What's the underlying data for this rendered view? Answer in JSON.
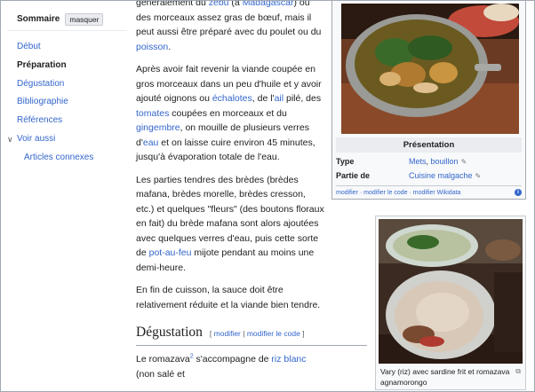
{
  "toc": {
    "title": "Sommaire",
    "hide_label": "masquer",
    "items": [
      {
        "label": "Début"
      },
      {
        "label": "Préparation"
      },
      {
        "label": "Dégustation"
      },
      {
        "label": "Bibliographie"
      },
      {
        "label": "Références"
      },
      {
        "label": "Voir aussi"
      },
      {
        "label": "Articles connexes"
      }
    ]
  },
  "content": {
    "p1_a": "généralement du ",
    "p1_zebu": "zébu",
    "p1_b": " (à ",
    "p1_madagascar": "Madagascar",
    "p1_c": ") ou des morceaux assez gras de bœuf, mais il peut aussi être préparé avec du poulet ou du ",
    "p1_poisson": "poisson",
    "p1_d": ".",
    "p2_a": "Après avoir fait revenir la viande coupée en gros morceaux dans un peu d'huile et y avoir ajouté oignons ou ",
    "p2_echalotes": "échalotes",
    "p2_b": ", de l'",
    "p2_ail": "ail",
    "p2_c": " pilé, des ",
    "p2_tomates": "tomates",
    "p2_d": " coupées en morceaux et du ",
    "p2_gingembre": "gingembre",
    "p2_e": ", on mouille de plusieurs verres d'",
    "p2_eau": "eau",
    "p2_f": " et on laisse cuire environ 45 minutes, jusqu'à évaporation totale de l'eau.",
    "p3_a": "Les parties tendres des brèdes (brèdes mafana, brèdes morelle, brèdes cresson, etc.) et quelques \"fleurs\" (des boutons floraux en fait) du brède mafana sont alors ajoutées avec quelques verres d'eau, puis cette sorte de ",
    "p3_potaufeu": "pot-au-feu",
    "p3_b": " mijote pendant au moins une demi-heure.",
    "p4": "En fin de cuisson, la sauce doit être relativement réduite et la viande bien tendre.",
    "h2": "Dégustation",
    "h2_edit_open": "[ ",
    "h2_edit_modifier": "modifier",
    "h2_edit_sep": " | ",
    "h2_edit_code": "modifier le code",
    "h2_edit_close": " ]",
    "p5_a": "Le romazava",
    "p5_ref": "2",
    "p5_b": " s'accompagne de ",
    "p5_riz": "riz blanc",
    "p5_c": " (non salé et"
  },
  "infobox": {
    "header": "Présentation",
    "rows": [
      {
        "key": "Type",
        "v1": "Mets",
        "sep": ", ",
        "v2": "bouillon"
      },
      {
        "key": "Partie de",
        "v1": "Cuisine malgache"
      }
    ],
    "footer": "modifier · modifier le code · modifier Wikidata",
    "info": "i"
  },
  "thumb": {
    "caption": "Vary (riz) avec sardine frit et romazava agnamorongo"
  },
  "colors": {
    "link": "#3366cc",
    "text": "#202122",
    "border": "#a2a9b1"
  }
}
